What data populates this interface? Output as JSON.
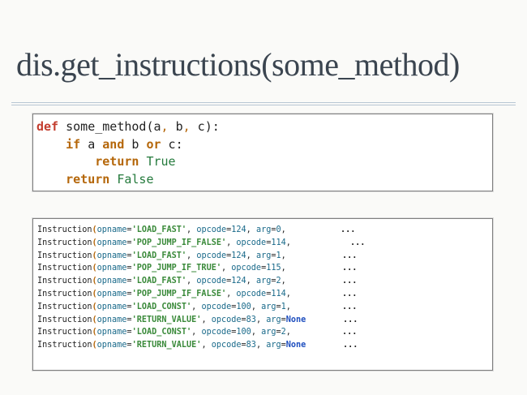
{
  "slide": {
    "title": "dis.get_instructions(some_method)"
  },
  "code": {
    "line1": {
      "kw": "def",
      "rest_a": " some_method(a",
      "comma1": ",",
      "rest_b": " b",
      "comma2": ",",
      "rest_c": " c):"
    },
    "line2": {
      "indent": "    ",
      "kw": "if",
      "a": " a ",
      "and": "and",
      "b": " b ",
      "or": "or",
      "c": " c:"
    },
    "line3": {
      "indent": "        ",
      "kw": "return",
      "sp": " ",
      "val": "True"
    },
    "line4": {
      "indent": "    ",
      "kw": "return",
      "sp": " ",
      "val": "False"
    }
  },
  "instructions": [
    {
      "name": "Instruction",
      "opname_key": "opname",
      "opname": "'LOAD_FAST'",
      "opcode_key": "opcode",
      "opcode": "124",
      "arg_key": "arg",
      "arg": "0",
      "ellipsis": "..."
    },
    {
      "name": "Instruction",
      "opname_key": "opname",
      "opname": "'POP_JUMP_IF_FALSE'",
      "opcode_key": "opcode",
      "opcode": "114",
      "arg_key": "",
      "arg": "",
      "ellipsis": "..."
    },
    {
      "name": "Instruction",
      "opname_key": "opname",
      "opname": "'LOAD_FAST'",
      "opcode_key": "opcode",
      "opcode": "124",
      "arg_key": "arg",
      "arg": "1",
      "ellipsis": "..."
    },
    {
      "name": "Instruction",
      "opname_key": "opname",
      "opname": "'POP_JUMP_IF_TRUE'",
      "opcode_key": "opcode",
      "opcode": "115",
      "arg_key": "",
      "arg": "",
      "ellipsis": "..."
    },
    {
      "name": "Instruction",
      "opname_key": "opname",
      "opname": "'LOAD_FAST'",
      "opcode_key": "opcode",
      "opcode": "124",
      "arg_key": "arg",
      "arg": "2",
      "ellipsis": "..."
    },
    {
      "name": "Instruction",
      "opname_key": "opname",
      "opname": "'POP_JUMP_IF_FALSE'",
      "opcode_key": "opcode",
      "opcode": "114",
      "arg_key": "",
      "arg": "",
      "ellipsis": "..."
    },
    {
      "name": "Instruction",
      "opname_key": "opname",
      "opname": "'LOAD_CONST'",
      "opcode_key": "opcode",
      "opcode": "100",
      "arg_key": "arg",
      "arg": "1",
      "ellipsis": "..."
    },
    {
      "name": "Instruction",
      "opname_key": "opname",
      "opname": "'RETURN_VALUE'",
      "opcode_key": "opcode",
      "opcode": "83",
      "arg_key": "arg",
      "arg": "None",
      "ellipsis": "..."
    },
    {
      "name": "Instruction",
      "opname_key": "opname",
      "opname": "'LOAD_CONST'",
      "opcode_key": "opcode",
      "opcode": "100",
      "arg_key": "arg",
      "arg": "2",
      "ellipsis": "..."
    },
    {
      "name": "Instruction",
      "opname_key": "opname",
      "opname": "'RETURN_VALUE'",
      "opcode_key": "opcode",
      "opcode": "83",
      "arg_key": "arg",
      "arg": "None",
      "ellipsis": "..."
    }
  ],
  "colors": {
    "title": "#3b4550",
    "keyword": "#b5670a",
    "def_keyword": "#c33d2e",
    "constant": "#247a3c",
    "string": "#3a8a3a",
    "attribute": "#1a6a8a",
    "none_literal": "#1f4fbf"
  }
}
